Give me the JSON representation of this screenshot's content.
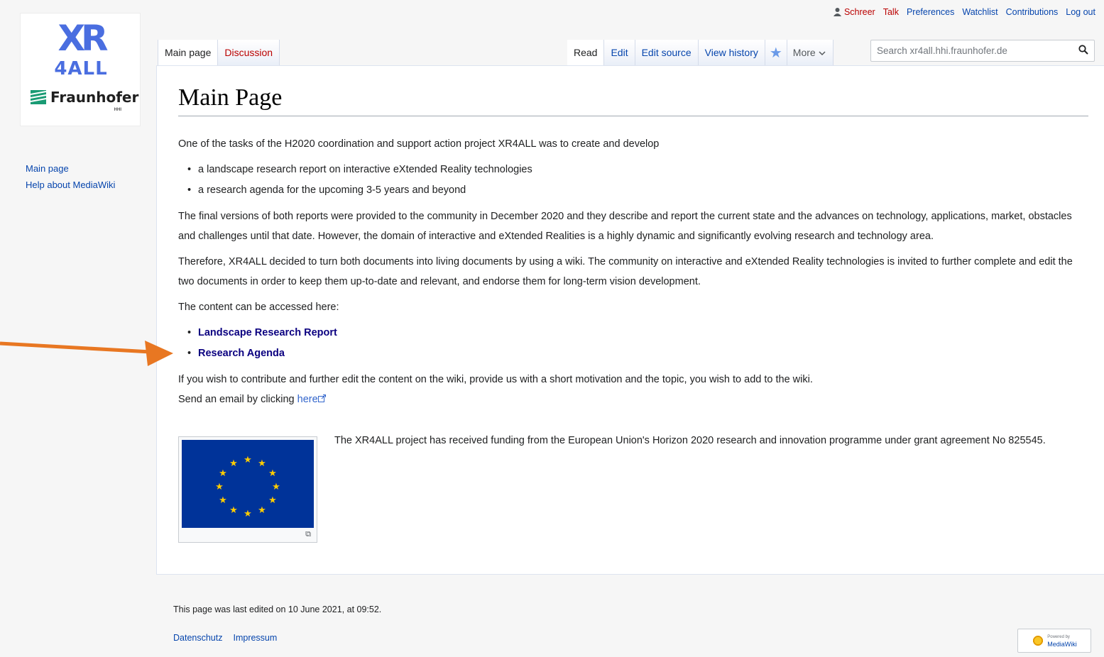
{
  "logo": {
    "brand_top": "XR",
    "brand_bottom": "4ALL",
    "org": "Fraunhofer",
    "org_sub": "HHI"
  },
  "personal_tools": {
    "user": "Schreer",
    "talk": "Talk",
    "preferences": "Preferences",
    "watchlist": "Watchlist",
    "contributions": "Contributions",
    "logout": "Log out"
  },
  "tabs": {
    "left": [
      "Main page",
      "Discussion"
    ],
    "right": [
      "Read",
      "Edit",
      "Edit source",
      "View history"
    ],
    "more": "More"
  },
  "search": {
    "placeholder": "Search xr4all.hhi.fraunhofer.de"
  },
  "sidebar": {
    "items": [
      "Main page",
      "Help about MediaWiki"
    ]
  },
  "page": {
    "title": "Main Page",
    "intro": "One of the tasks of the H2020 coordination and support action project XR4ALL was to create and develop",
    "intro_items": [
      "a landscape research report on interactive eXtended Reality technologies",
      "a research agenda for the upcoming 3-5 years and beyond"
    ],
    "para2": "The final versions of both reports were provided to the community in December 2020 and they describe and report the current state and the advances on technology, applications, market, obstacles and challenges until that date. However, the domain of interactive and eXtended Realities is a highly dynamic and significantly evolving research and technology area.",
    "para3": "Therefore, XR4ALL decided to turn both documents into living documents by using a wiki. The community on interactive and eXtended Reality technologies is invited to further complete and edit the two documents in order to keep them up-to-date and relevant, and endorse them for long-term vision development.",
    "access_text": "The content can be accessed here:",
    "links": [
      "Landscape Research Report",
      "Research Agenda"
    ],
    "contribute": "If you wish to contribute and further edit the content on the wiki, provide us with a short motivation and the topic, you wish to add to the wiki.",
    "email_prefix": "Send an email by clicking ",
    "email_link": "here",
    "funding": "The XR4ALL project has received funding from the European Union's Horizon 2020 research and innovation programme under grant agreement No 825545."
  },
  "footer": {
    "last_modified": "This page was last edited on 10 June 2021, at 09:52.",
    "links": [
      "Datenschutz",
      "Impressum"
    ],
    "powered_top": "Powered by",
    "powered_bottom": "MediaWiki"
  },
  "colors": {
    "link": "#0645ad",
    "new_link": "#ba0000",
    "visited_bold_link": "#0b0080",
    "eu_blue": "#003399",
    "eu_star": "#ffcc00",
    "annotation_arrow": "#e87722",
    "logo_blue": "#4a6ee0"
  },
  "icons": [
    "user-icon",
    "watch-star-icon",
    "chevron-down-icon",
    "search-icon",
    "external-link-icon",
    "enlarge-icon",
    "annotation-arrow"
  ]
}
